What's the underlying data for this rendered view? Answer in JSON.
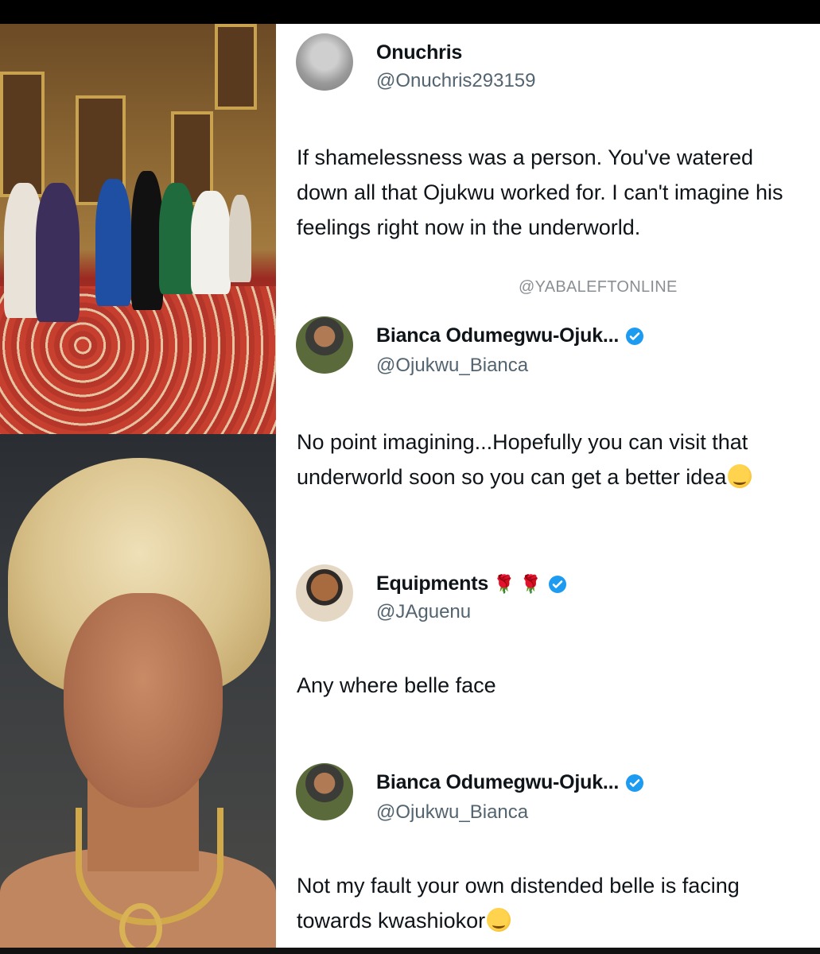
{
  "tweets": [
    {
      "name": "Onuchris",
      "handle": "@Onuchris293159",
      "verified": false,
      "text": "If shamelessness was a person. You've watered down all that Ojukwu worked for. I can't imagine his feelings right now in the underworld."
    },
    {
      "name": "Bianca Odumegwu-Ojuk...",
      "handle": "@Ojukwu_Bianca",
      "verified": true,
      "text": "No point imagining...Hopefully you can visit that underworld soon so you can get a better idea",
      "trailing_emoji": "melting-face-emoji"
    },
    {
      "name": "Equipments",
      "handle": "@JAguenu",
      "verified": true,
      "name_emojis": [
        "rose-emoji",
        "rose-emoji"
      ],
      "text": "Any where belle face"
    },
    {
      "name": "Bianca Odumegwu-Ojuk...",
      "handle": "@Ojukwu_Bianca",
      "verified": true,
      "text": "Not my fault your own distended belle is facing towards kwashiokor",
      "trailing_emoji": "melting-face-emoji"
    }
  ],
  "watermark": "@YABALEFTONLINE",
  "colors": {
    "verified": "#1d9bf0",
    "text": "#0f1419",
    "muted": "#536471"
  }
}
